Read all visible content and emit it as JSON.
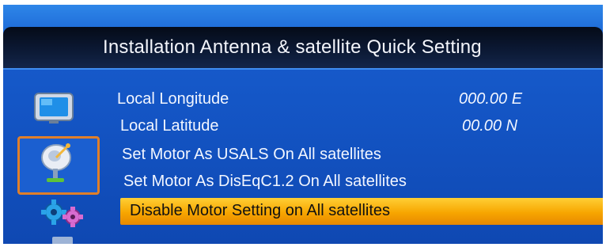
{
  "header": {
    "title": "Installation Antenna & satellite Quick Setting"
  },
  "sidebar": {
    "icons": [
      {
        "name": "tv-icon",
        "selected": false
      },
      {
        "name": "satellite-dish-icon",
        "selected": true
      },
      {
        "name": "gears-icon",
        "selected": false
      }
    ]
  },
  "menu": {
    "items": [
      {
        "label": "Local Longitude",
        "value": "000.00 E"
      },
      {
        "label": "Local Latitude",
        "value": "00.00 N"
      },
      {
        "label": "Set Motor As USALS On All satellites"
      },
      {
        "label": "Set Motor As DisEqC1.2 On All satellites"
      },
      {
        "label": "Disable Motor Setting on All satellites",
        "selected": true
      }
    ]
  },
  "colors": {
    "background": "#1456c6",
    "title_bar": "#0c1a36",
    "highlight": "#f7a600",
    "selected_icon_border": "#e07f2a",
    "text": "#f2f6ff"
  }
}
